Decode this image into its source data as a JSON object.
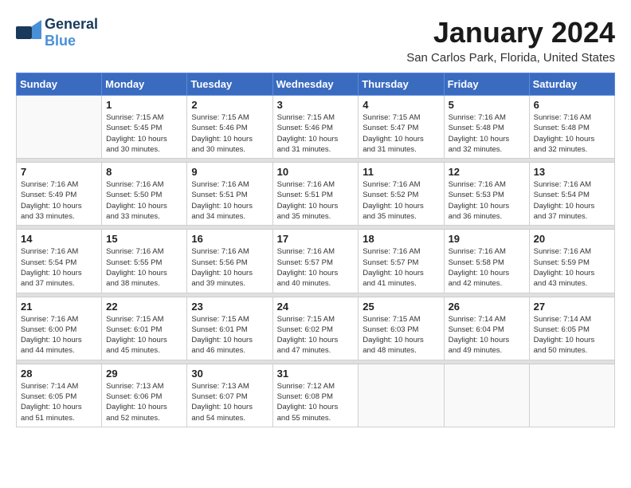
{
  "header": {
    "logo_general": "General",
    "logo_blue": "Blue",
    "title": "January 2024",
    "location": "San Carlos Park, Florida, United States"
  },
  "weekdays": [
    "Sunday",
    "Monday",
    "Tuesday",
    "Wednesday",
    "Thursday",
    "Friday",
    "Saturday"
  ],
  "weeks": [
    [
      {
        "day": "",
        "info": ""
      },
      {
        "day": "1",
        "info": "Sunrise: 7:15 AM\nSunset: 5:45 PM\nDaylight: 10 hours\nand 30 minutes."
      },
      {
        "day": "2",
        "info": "Sunrise: 7:15 AM\nSunset: 5:46 PM\nDaylight: 10 hours\nand 30 minutes."
      },
      {
        "day": "3",
        "info": "Sunrise: 7:15 AM\nSunset: 5:46 PM\nDaylight: 10 hours\nand 31 minutes."
      },
      {
        "day": "4",
        "info": "Sunrise: 7:15 AM\nSunset: 5:47 PM\nDaylight: 10 hours\nand 31 minutes."
      },
      {
        "day": "5",
        "info": "Sunrise: 7:16 AM\nSunset: 5:48 PM\nDaylight: 10 hours\nand 32 minutes."
      },
      {
        "day": "6",
        "info": "Sunrise: 7:16 AM\nSunset: 5:48 PM\nDaylight: 10 hours\nand 32 minutes."
      }
    ],
    [
      {
        "day": "7",
        "info": "Sunrise: 7:16 AM\nSunset: 5:49 PM\nDaylight: 10 hours\nand 33 minutes."
      },
      {
        "day": "8",
        "info": "Sunrise: 7:16 AM\nSunset: 5:50 PM\nDaylight: 10 hours\nand 33 minutes."
      },
      {
        "day": "9",
        "info": "Sunrise: 7:16 AM\nSunset: 5:51 PM\nDaylight: 10 hours\nand 34 minutes."
      },
      {
        "day": "10",
        "info": "Sunrise: 7:16 AM\nSunset: 5:51 PM\nDaylight: 10 hours\nand 35 minutes."
      },
      {
        "day": "11",
        "info": "Sunrise: 7:16 AM\nSunset: 5:52 PM\nDaylight: 10 hours\nand 35 minutes."
      },
      {
        "day": "12",
        "info": "Sunrise: 7:16 AM\nSunset: 5:53 PM\nDaylight: 10 hours\nand 36 minutes."
      },
      {
        "day": "13",
        "info": "Sunrise: 7:16 AM\nSunset: 5:54 PM\nDaylight: 10 hours\nand 37 minutes."
      }
    ],
    [
      {
        "day": "14",
        "info": "Sunrise: 7:16 AM\nSunset: 5:54 PM\nDaylight: 10 hours\nand 37 minutes."
      },
      {
        "day": "15",
        "info": "Sunrise: 7:16 AM\nSunset: 5:55 PM\nDaylight: 10 hours\nand 38 minutes."
      },
      {
        "day": "16",
        "info": "Sunrise: 7:16 AM\nSunset: 5:56 PM\nDaylight: 10 hours\nand 39 minutes."
      },
      {
        "day": "17",
        "info": "Sunrise: 7:16 AM\nSunset: 5:57 PM\nDaylight: 10 hours\nand 40 minutes."
      },
      {
        "day": "18",
        "info": "Sunrise: 7:16 AM\nSunset: 5:57 PM\nDaylight: 10 hours\nand 41 minutes."
      },
      {
        "day": "19",
        "info": "Sunrise: 7:16 AM\nSunset: 5:58 PM\nDaylight: 10 hours\nand 42 minutes."
      },
      {
        "day": "20",
        "info": "Sunrise: 7:16 AM\nSunset: 5:59 PM\nDaylight: 10 hours\nand 43 minutes."
      }
    ],
    [
      {
        "day": "21",
        "info": "Sunrise: 7:16 AM\nSunset: 6:00 PM\nDaylight: 10 hours\nand 44 minutes."
      },
      {
        "day": "22",
        "info": "Sunrise: 7:15 AM\nSunset: 6:01 PM\nDaylight: 10 hours\nand 45 minutes."
      },
      {
        "day": "23",
        "info": "Sunrise: 7:15 AM\nSunset: 6:01 PM\nDaylight: 10 hours\nand 46 minutes."
      },
      {
        "day": "24",
        "info": "Sunrise: 7:15 AM\nSunset: 6:02 PM\nDaylight: 10 hours\nand 47 minutes."
      },
      {
        "day": "25",
        "info": "Sunrise: 7:15 AM\nSunset: 6:03 PM\nDaylight: 10 hours\nand 48 minutes."
      },
      {
        "day": "26",
        "info": "Sunrise: 7:14 AM\nSunset: 6:04 PM\nDaylight: 10 hours\nand 49 minutes."
      },
      {
        "day": "27",
        "info": "Sunrise: 7:14 AM\nSunset: 6:05 PM\nDaylight: 10 hours\nand 50 minutes."
      }
    ],
    [
      {
        "day": "28",
        "info": "Sunrise: 7:14 AM\nSunset: 6:05 PM\nDaylight: 10 hours\nand 51 minutes."
      },
      {
        "day": "29",
        "info": "Sunrise: 7:13 AM\nSunset: 6:06 PM\nDaylight: 10 hours\nand 52 minutes."
      },
      {
        "day": "30",
        "info": "Sunrise: 7:13 AM\nSunset: 6:07 PM\nDaylight: 10 hours\nand 54 minutes."
      },
      {
        "day": "31",
        "info": "Sunrise: 7:12 AM\nSunset: 6:08 PM\nDaylight: 10 hours\nand 55 minutes."
      },
      {
        "day": "",
        "info": ""
      },
      {
        "day": "",
        "info": ""
      },
      {
        "day": "",
        "info": ""
      }
    ]
  ]
}
